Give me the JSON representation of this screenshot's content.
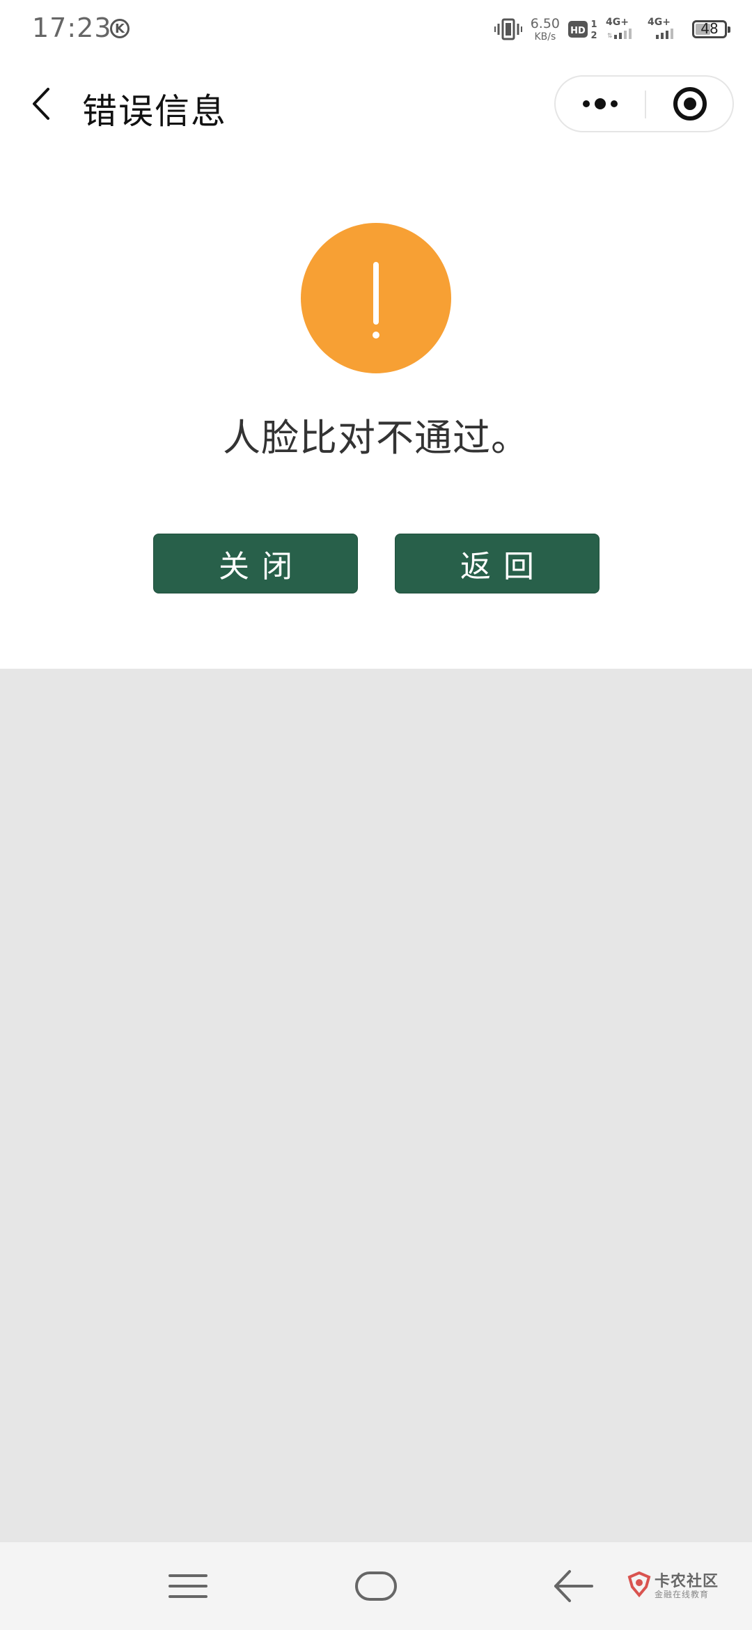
{
  "status_bar": {
    "time": "17:23",
    "app_icon": "k-circle-icon",
    "network_speed": "6.50",
    "network_speed_unit": "KB/s",
    "hd_badge": "HD",
    "hd_sim1": "1",
    "hd_sim2": "2",
    "sim1_network": "4G+",
    "sim2_network": "4G+",
    "battery_level": "48",
    "battery_fraction": 0.48
  },
  "title_bar": {
    "title": "错误信息",
    "back_icon": "chevron-left-icon",
    "more_icon": "more-dots-icon",
    "close_icon": "target-close-icon"
  },
  "content": {
    "icon": "warning-exclamation-icon",
    "icon_color": "#f7a034",
    "message": "人脸比对不通过。",
    "buttons": {
      "close_label": "关闭",
      "back_label": "返回"
    },
    "button_color": "#28604a"
  },
  "nav_bar": {
    "menu_icon": "menu-lines-icon",
    "home_icon": "home-rounded-rect-icon",
    "back_icon": "arrow-left-icon"
  },
  "watermark": {
    "title": "卡农社区",
    "subtitle": "金融在线教育"
  }
}
